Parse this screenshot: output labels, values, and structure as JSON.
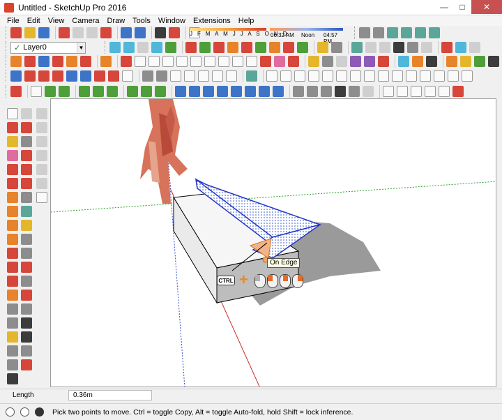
{
  "window": {
    "title": "Untitled - SketchUp Pro 2016"
  },
  "menu": [
    "File",
    "Edit",
    "View",
    "Camera",
    "Draw",
    "Tools",
    "Window",
    "Extensions",
    "Help"
  ],
  "layers": {
    "current": "Layer0"
  },
  "shadow": {
    "months": "J F M A M J J A S O N D",
    "time_start": "06:32 AM",
    "time_mid": "Noon",
    "time_end": "04:57 PM"
  },
  "viewport": {
    "tooltip": "On Edge",
    "modifier_key": "CTRL",
    "axis_colors": {
      "red": "#d02a2a",
      "green": "#2ea02e",
      "blue": "#3050d0"
    }
  },
  "measurement": {
    "label": "Length",
    "value": "0.36m"
  },
  "status": {
    "hint": "Pick two points to move.  Ctrl = toggle Copy, Alt = toggle Auto-fold, hold Shift = lock inference."
  }
}
